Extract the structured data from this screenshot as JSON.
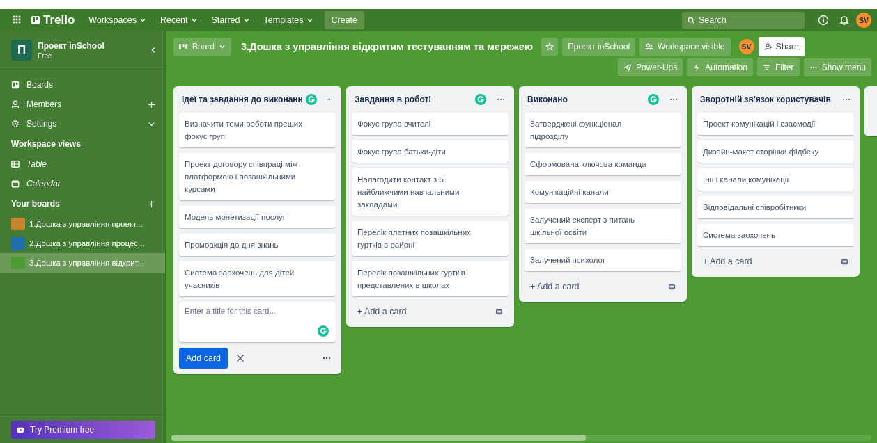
{
  "topbar": {
    "logo": "Trello",
    "menus": [
      {
        "label": "Workspaces"
      },
      {
        "label": "Recent"
      },
      {
        "label": "Starred"
      },
      {
        "label": "Templates"
      }
    ],
    "create": "Create",
    "search": {
      "placeholder": "Search"
    },
    "avatar": "SV"
  },
  "sidebar": {
    "workspace": {
      "initial": "П",
      "name": "Проект inSchool",
      "plan": "Free"
    },
    "nav": [
      {
        "kind": "boards",
        "label": "Boards"
      },
      {
        "kind": "members",
        "label": "Members",
        "add_button": true
      },
      {
        "kind": "settings",
        "label": "Settings",
        "expand_button": true
      }
    ],
    "views_heading": "Workspace views",
    "views": [
      {
        "kind": "table",
        "label": "Table"
      },
      {
        "kind": "calendar",
        "label": "Calendar"
      }
    ],
    "boards_heading": "Your boards",
    "boards": [
      {
        "label": "1.Дошка з управління проект...",
        "color": "#c6862f",
        "selected": false
      },
      {
        "label": "2.Дошка з управління процес...",
        "color": "#1f6fa8",
        "selected": false
      },
      {
        "label": "3.Дошка з управління відкрит...",
        "color": "#4e9a33",
        "selected": true
      }
    ],
    "premium": "Try Premium free"
  },
  "board": {
    "view": "Board",
    "title": "3.Дошка з управління відкритим тестуванням та мережею",
    "workspace": "Проект inSchool",
    "visibility": "Workspace visible",
    "avatar": "SV",
    "share": "Share",
    "tools": [
      {
        "kind": "powerups",
        "label": "Power-Ups"
      },
      {
        "kind": "automation",
        "label": "Automation"
      },
      {
        "kind": "filter",
        "label": "Filter"
      },
      {
        "kind": "menu",
        "label": "Show menu"
      }
    ]
  },
  "lists": [
    {
      "title": "Ідеї та завдання до виконанн",
      "grammarly": true,
      "cards": [
        "Визначити теми роботи преших фокус груп",
        "Проект договору співпраці між платформою і позашкільними курсами",
        "Модель монетизації послуг",
        "Промоакція до дня знань",
        "Система заохочень для дітей учасників"
      ],
      "composer": {
        "placeholder": "Enter a title for this card...",
        "button": "Add card"
      }
    },
    {
      "title": "Завдання в роботі",
      "grammarly": true,
      "cards": [
        "Фокус група вчителі",
        "Фокус група батьки-діти",
        "Налагодити контакт з 5 найближчими навчальними закладами",
        "Перелік платних позашкільних гуртків в районі",
        "Перелік позашкільних гуртків представлених в школах"
      ],
      "add": "+ Add a card"
    },
    {
      "title": "Виконано",
      "grammarly": true,
      "cards": [
        "Затверджені функціонал підрозділу",
        "Сформована ключова команда",
        "Комунікаційні канали",
        "Залучений експерт з питань шкільної освіти",
        "Залучений психолог"
      ],
      "add": "+ Add a card"
    },
    {
      "title": "Зворотній зв'язок користувачів",
      "grammarly": false,
      "cards": [
        "Проект комунікацій і взаємодії",
        "Дизайн-макет сторінки фідбеку",
        "Інші канали комунікації",
        "Відповідальні співробітники",
        "Система заохочень"
      ],
      "add": "+ Add a card"
    }
  ]
}
